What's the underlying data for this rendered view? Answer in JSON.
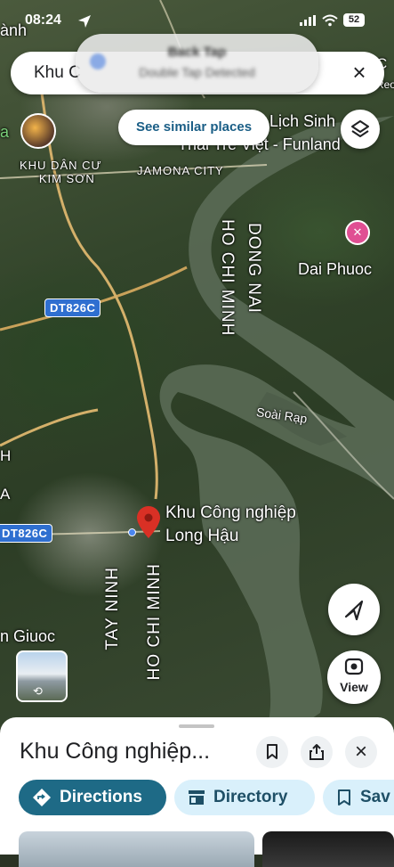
{
  "status_bar": {
    "time": "08:24",
    "battery": "52"
  },
  "toast": {
    "title": "Back Tap",
    "subtitle": "Double Tap Detected"
  },
  "search": {
    "value": "Khu C",
    "close_icon": "close-icon"
  },
  "similar_chip": {
    "label": "See similar places"
  },
  "map": {
    "labels": {
      "anh": "ành",
      "a_left": "a",
      "dan_cu_line1": "KHU DÂN CƯ",
      "dan_cu_line2": "KIM SƠN",
      "jamona": "JAMONA CITY",
      "lich_sinh_line1": "Lịch Sinh",
      "lich_sinh_line2": "Thái Trẻ Việt - Funland",
      "ho_chi_minh_top": "HO CHI MINH",
      "dong_nai": "DONG NAI",
      "dai_phuoc": "Dai Phuoc",
      "soai_rap": "Soài Rạp",
      "pin_line1": "Khu Công nghiệp",
      "pin_line2": "Long Hậu",
      "tay_ninh": "TAY NINH",
      "ho_chi_minh_bottom": "HO CHI MINH",
      "giuoc": "n Giuoc",
      "c_right": "C",
      "reo_right": "Reo",
      "h_left": "H",
      "a_left_lower": "A"
    },
    "road_badges": [
      "DT826C",
      "DT826C"
    ],
    "view_button": "View"
  },
  "sheet": {
    "title": "Khu Công nghiệp...",
    "buttons": {
      "directions": "Directions",
      "directory": "Directory",
      "save": "Sav"
    }
  },
  "colors": {
    "primary_teal": "#1e6a86",
    "pill_light": "#d9f0fb",
    "pin_red": "#d93025",
    "road_blue": "#2f6fd0",
    "poi_pink": "#e04f93"
  }
}
